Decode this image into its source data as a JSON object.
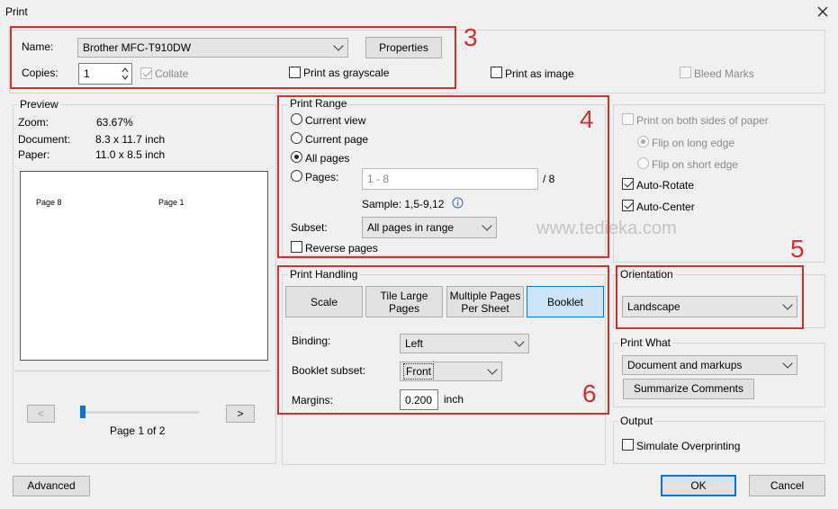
{
  "window": {
    "title": "Print"
  },
  "printer": {
    "name_label": "Name:",
    "name_value": "Brother MFC-T910DW",
    "properties_label": "Properties",
    "copies_label": "Copies:",
    "copies_value": "1",
    "collate_label": "Collate",
    "grayscale_label": "Print as grayscale",
    "print_as_image_label": "Print as image",
    "bleed_marks_label": "Bleed Marks"
  },
  "preview": {
    "title": "Preview",
    "zoom_label": "Zoom:",
    "zoom_value": "63.67%",
    "document_label": "Document:",
    "document_value": "8.3 x 11.7 inch",
    "paper_label": "Paper:",
    "paper_value": "11.0 x 8.5 inch",
    "left_page": "Page 8",
    "right_page": "Page 1",
    "prev_label": "<",
    "next_label": ">",
    "page_indicator": "Page 1 of 2",
    "slider_fraction": 0.0
  },
  "print_range": {
    "title": "Print Range",
    "current_view": "Current view",
    "current_page": "Current page",
    "all_pages": "All pages",
    "pages_label": "Pages:",
    "pages_placeholder": "1 - 8",
    "pages_total": "/ 8",
    "sample": "Sample: 1,5-9,12",
    "subset_label": "Subset:",
    "subset_value": "All pages in range",
    "reverse_label": "Reverse pages"
  },
  "print_handling": {
    "title": "Print Handling",
    "tabs": [
      {
        "line1": "Scale",
        "line2": ""
      },
      {
        "line1": "Tile Large",
        "line2": "Pages"
      },
      {
        "line1": "Multiple Pages",
        "line2": "Per Sheet"
      },
      {
        "line1": "Booklet",
        "line2": ""
      }
    ],
    "binding_label": "Binding:",
    "binding_value": "Left",
    "booklet_subset_label": "Booklet subset:",
    "booklet_subset_value": "Front",
    "margins_label": "Margins:",
    "margins_value": "0.200",
    "margins_unit": "inch"
  },
  "duplex": {
    "both_sides": "Print on both sides of paper",
    "long_edge": "Flip on long edge",
    "short_edge": "Flip on short edge",
    "auto_rotate": "Auto-Rotate",
    "auto_center": "Auto-Center"
  },
  "watermark": "www.tediekа.com",
  "orientation": {
    "title": "Orientation",
    "value": "Landscape"
  },
  "print_what": {
    "title": "Print What",
    "value": "Document and markups",
    "summarize_label": "Summarize Comments"
  },
  "output": {
    "title": "Output",
    "simulate_label": "Simulate Overprinting"
  },
  "footer": {
    "advanced_label": "Advanced",
    "ok_label": "OK",
    "cancel_label": "Cancel"
  },
  "annotations": {
    "n3": "3",
    "n4": "4",
    "n5": "5",
    "n6": "6"
  },
  "colors": {
    "annotation": "#d32f2f",
    "accent": "#0078d7",
    "active_tab": "#cce4f7"
  }
}
